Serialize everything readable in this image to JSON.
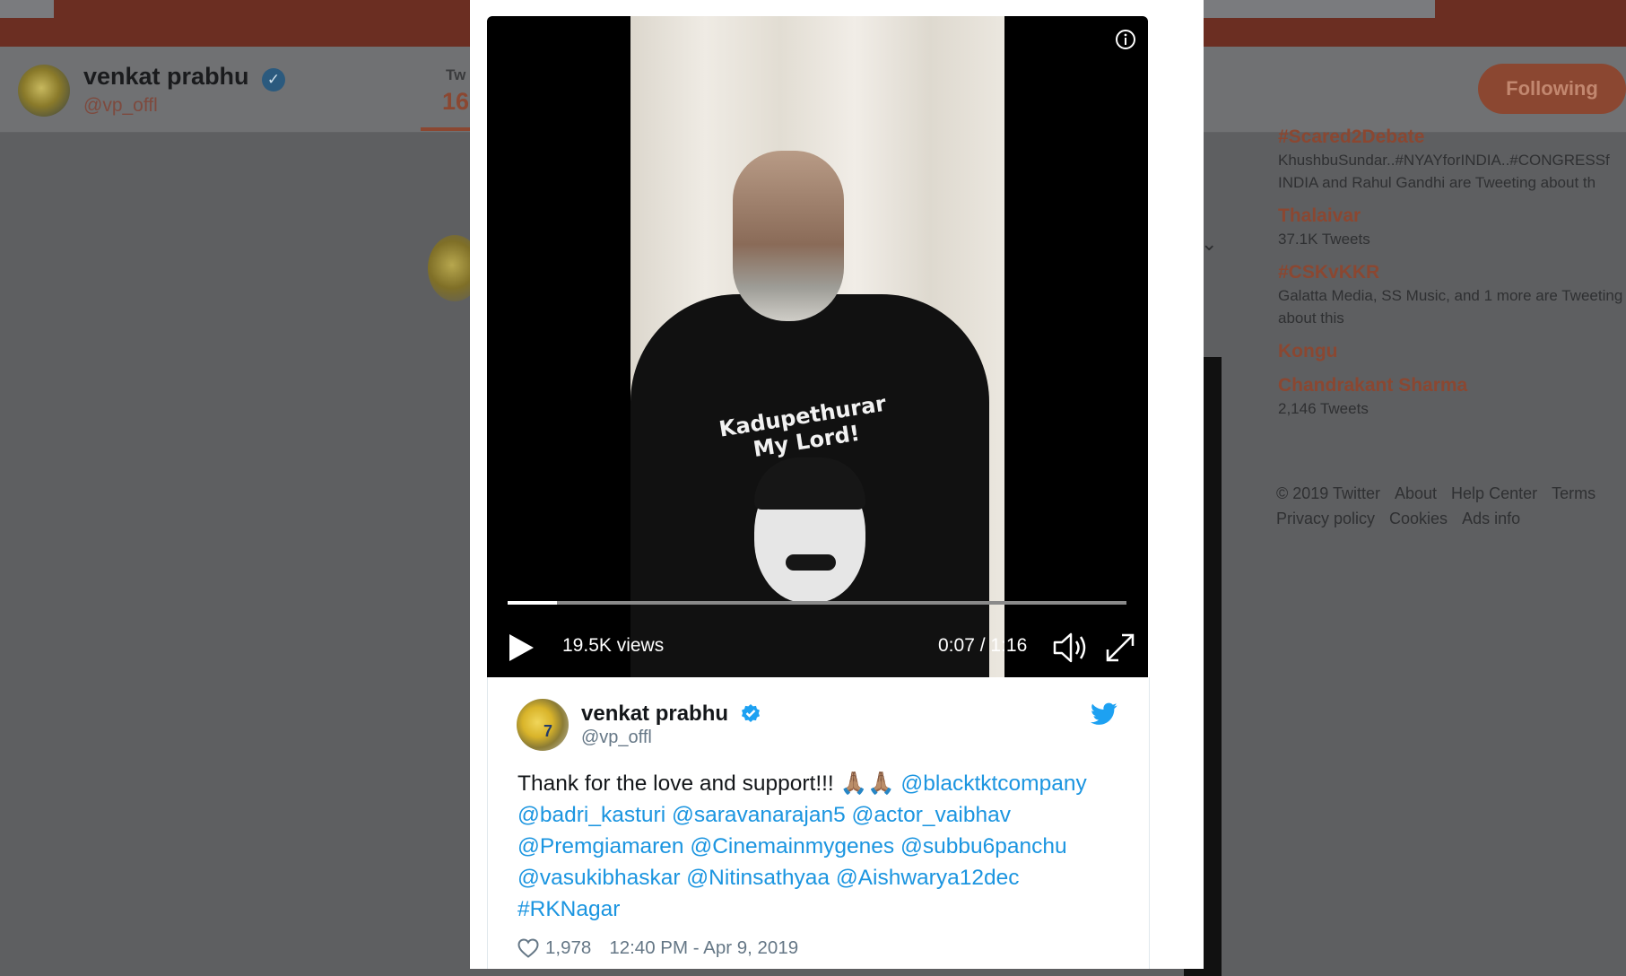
{
  "background": {
    "profile": {
      "name": "venkat prabhu",
      "handle": "@vp_offl",
      "tab_label": "Tw",
      "tab_count": "16",
      "following_button": "Following"
    },
    "trends": [
      {
        "name": "#Scared2Debate",
        "meta": "KhushbuSundar..#NYAYforINDIA..#CONGRESSf INDIA and Rahul Gandhi are Tweeting about th"
      },
      {
        "name": "Thalaivar",
        "meta": "37.1K Tweets"
      },
      {
        "name": "#CSKvKKR",
        "meta": "Galatta Media, SS Music, and 1 more are Tweeting about this"
      },
      {
        "name": "Kongu",
        "meta": ""
      },
      {
        "name": "Chandrakant Sharma",
        "meta": "2,146 Tweets"
      }
    ],
    "footer": [
      "© 2019 Twitter",
      "About",
      "Help Center",
      "Terms",
      "Privacy policy",
      "Cookies",
      "Ads info"
    ]
  },
  "video": {
    "shirt_text_line1": "Kadupethurar",
    "shirt_text_line2": "My Lord!",
    "views": "19.5K views",
    "time": "0:07 / 1:16",
    "progress": 0.08,
    "icons": [
      "info-icon",
      "play-icon",
      "volume-icon",
      "fullscreen-icon"
    ]
  },
  "tweet": {
    "name": "venkat prabhu",
    "handle": "@vp_offl",
    "body_text": "Thank for the love and support!!! ",
    "emoji": "🙏🏽🙏🏽",
    "mentions": [
      "@blacktktcompany",
      "@badri_kasturi",
      "@saravanarajan5",
      "@actor_vaibhav",
      "@Premgiamaren",
      "@Cinemainmygenes",
      "@subbu6panchu",
      "@vasukibhaskar",
      "@Nitinsathyaa",
      "@Aishwarya12dec",
      "#RKNagar"
    ],
    "likes": "1,978",
    "timestamp": "12:40 PM - Apr 9, 2019"
  },
  "colors": {
    "link": "#1b95e0",
    "verified": "#1da1f2",
    "dim_orange": "#8b4731"
  }
}
